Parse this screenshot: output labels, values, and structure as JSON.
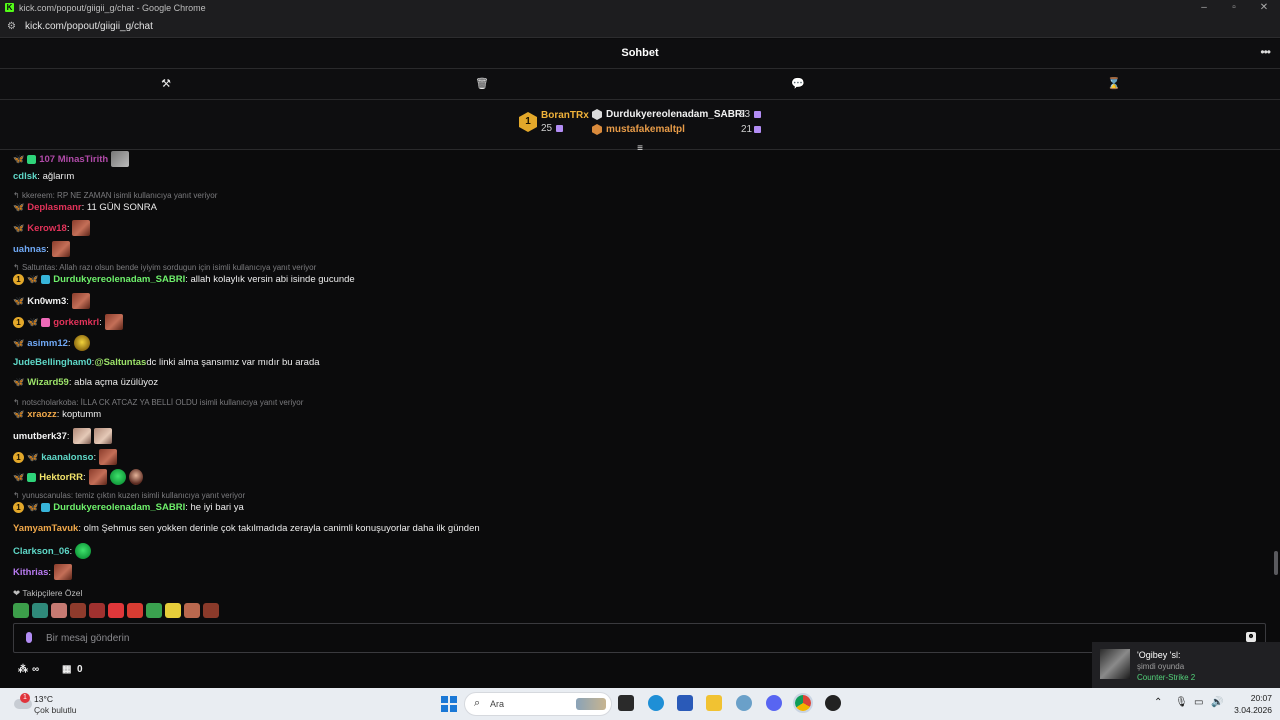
{
  "window": {
    "title": "kick.com/popout/giigii_g/chat - Google Chrome",
    "url": "kick.com/popout/giigii_g/chat"
  },
  "chat_header": {
    "title": "Sohbet"
  },
  "leaderboard": {
    "first": {
      "rank": "1",
      "name": "BoranTRx",
      "count": "25"
    },
    "second": {
      "name": "Durdukyereolenadam_SABRI",
      "count": "23"
    },
    "third": {
      "name": "mustafakemaltpl",
      "count": "21"
    }
  },
  "messages": [
    {
      "user": "107 MinasTirith",
      "text": ""
    },
    {
      "user": "cdlsk",
      "text": ": ağlarım"
    },
    {
      "reply": "kkereem: RP NE ZAMAN isimli kullanıcıya yanıt veriyor"
    },
    {
      "user": "Deplasmanr",
      "text": ": 11 GÜN SONRA"
    },
    {
      "user": "Kerow18",
      "text": ":"
    },
    {
      "user": "uahnas",
      "text": ":"
    },
    {
      "reply": "Saltuntas: Allah razı olsun bende iyiyim sordugun için isimli kullanıcıya yanıt veriyor"
    },
    {
      "user": "Durdukyereolenadam_SABRI",
      "text": ": allah kolaylık versin abi isinde gucunde"
    },
    {
      "user": "Kn0wm3",
      "text": ":"
    },
    {
      "user": "gorkemkrl",
      "text": ":"
    },
    {
      "user": "asimm12",
      "text": ":"
    },
    {
      "user": "JudeBellingham0",
      "text": ": ",
      "mention": "@Saltuntas",
      "text2": " dc linki alma şansımız var mıdır bu arada"
    },
    {
      "user": "Wizard59",
      "text": ": abla açma üzülüyoz"
    },
    {
      "reply": "notscholarkoba: İLLA CK ATCAZ YA BELLİ OLDU isimli kullanıcıya yanıt veriyor"
    },
    {
      "user": "xraozz",
      "text": ": koptumm"
    },
    {
      "user": "umutberk37",
      "text": ":"
    },
    {
      "user": "kaanalonso",
      "text": ":"
    },
    {
      "user": "HektorRR",
      "text": ":"
    },
    {
      "reply": "yunuscanulas: temiz çıktın kuzen isimli kullanıcıya yanıt veriyor"
    },
    {
      "user": "Durdukyereolenadam_SABRI",
      "text": ": he iyi bari ya"
    },
    {
      "user": "YamyamTavuk",
      "text": ": olm Şehmus sen yokken derinle çok takılmadıda zerayla canimli konuşuyorlar daha ilk günden"
    },
    {
      "user": "Clarkson_06",
      "text": ":"
    },
    {
      "user": "Kithrias",
      "text": ":"
    }
  ],
  "followers": {
    "label": "Takipçilere Özel"
  },
  "input": {
    "placeholder": "Bir mesaj gönderin"
  },
  "bottom_bar": {
    "points": "∞",
    "count": "0"
  },
  "toast": {
    "name": "'Ogibey 'sl:",
    "status": "şimdi oyunda",
    "game": "Counter-Strike 2"
  },
  "taskbar": {
    "temperature": "13°C",
    "condition": "Çok bulutlu",
    "search_label": "Ara",
    "time": "20:07",
    "date": "3.04.2026"
  },
  "colors": {
    "kick_green": "#53fc18",
    "leader_gold": "#e3a82a"
  }
}
